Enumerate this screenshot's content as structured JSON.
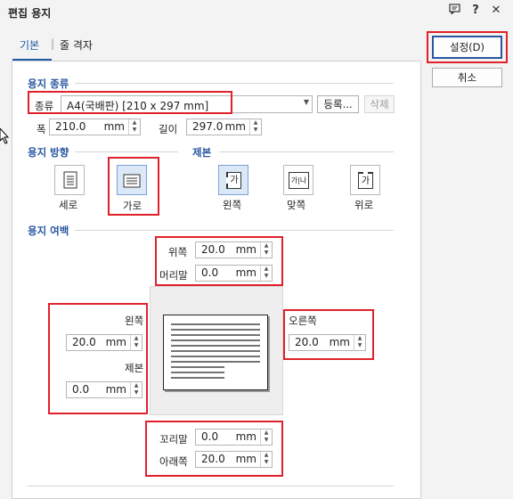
{
  "window": {
    "title": "편집 용지",
    "help_icon": "?",
    "close_icon": "✕",
    "chat_icon": "▭"
  },
  "tabs": [
    {
      "label": "기본"
    },
    {
      "label": "|"
    },
    {
      "label": "줄 격자"
    }
  ],
  "actions": {
    "ok_label": "설정(D)",
    "cancel_label": "취소"
  },
  "paper_type": {
    "section": "용지 종류",
    "type_label": "종류",
    "type_value": "A4(국배판) [210 x 297 mm]",
    "register_label": "등록...",
    "delete_label": "삭제",
    "width_label": "폭",
    "width_value": "210.0",
    "length_label": "길이",
    "length_value": "297.0",
    "unit": "mm"
  },
  "orientation": {
    "section": "용지 방향",
    "portrait_label": "세로",
    "landscape_label": "가로",
    "selected": "landscape"
  },
  "binding": {
    "section": "제본",
    "left_label": "왼쪽",
    "facing_label": "맞쪽",
    "top_label": "위로",
    "glyph": "가",
    "selected": "left"
  },
  "margins": {
    "section": "용지 여백",
    "top_label": "위쪽",
    "top_value": "20.0",
    "header_label": "머리말",
    "header_value": "0.0",
    "left_label": "왼쪽",
    "left_value": "20.0",
    "gutter_label": "제본",
    "gutter_value": "0.0",
    "right_label": "오른쪽",
    "right_value": "20.0",
    "footer_label": "꼬리말",
    "footer_value": "0.0",
    "bottom_label": "아래쪽",
    "bottom_value": "20.0",
    "unit": "mm"
  },
  "highlight_color": "#e0212b",
  "accent_color": "#2a57a0"
}
